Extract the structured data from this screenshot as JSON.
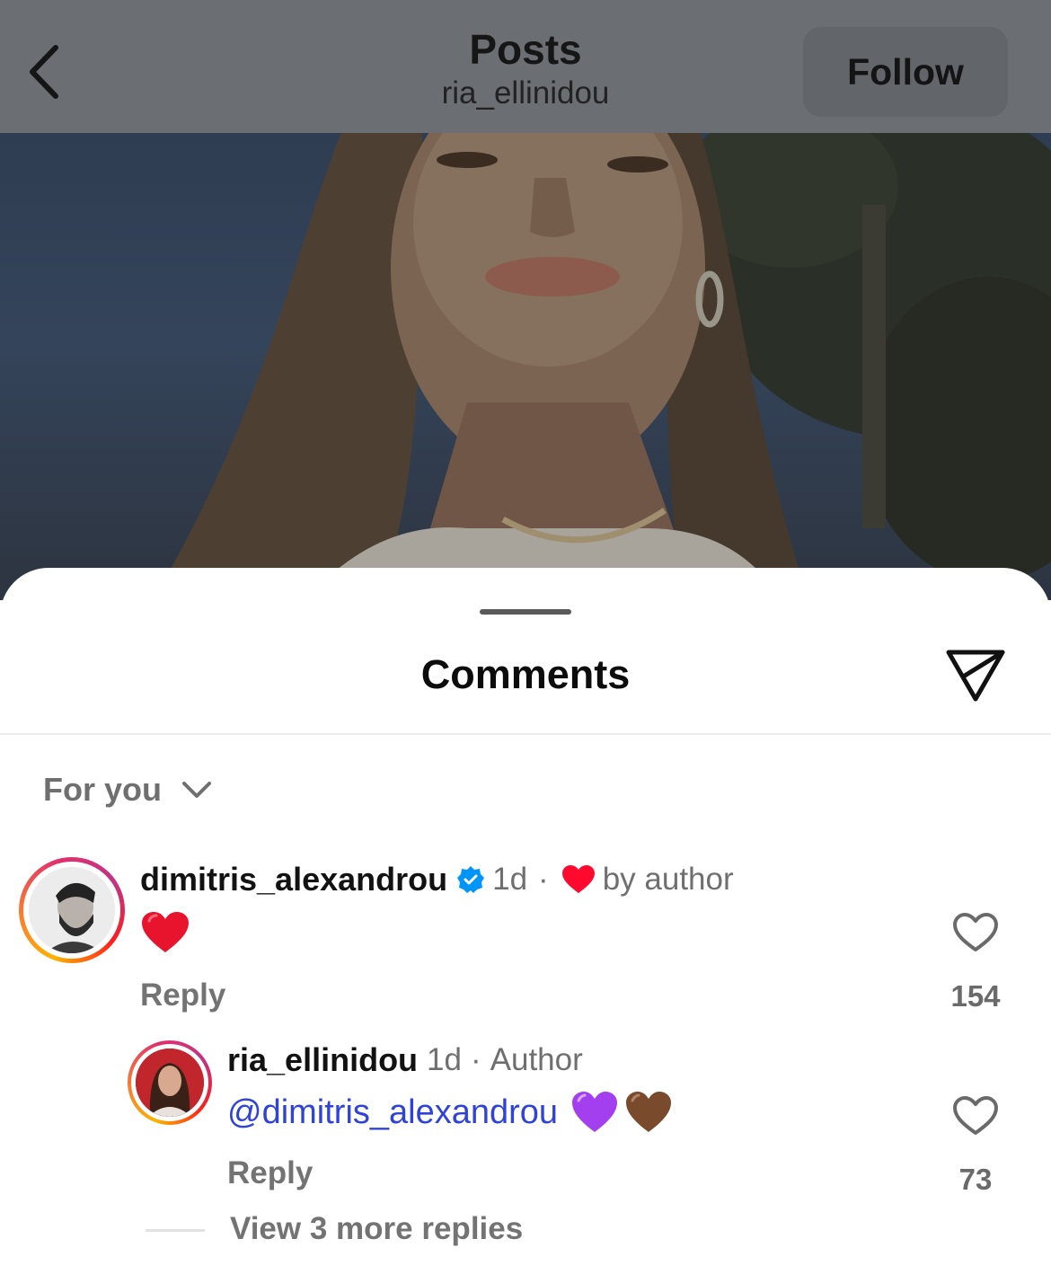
{
  "header": {
    "title": "Posts",
    "subtitle": "ria_ellinidou",
    "follow_label": "Follow"
  },
  "sheet": {
    "title": "Comments",
    "sort_label": "For you"
  },
  "comments": [
    {
      "username": "dimitris_alexandrou",
      "verified": true,
      "time": "1d",
      "separator": "·",
      "liked_by_author_text": "by author",
      "body_emoji": "❤️",
      "reply_label": "Reply",
      "like_count": "154"
    }
  ],
  "replies": [
    {
      "username": "ria_ellinidou",
      "time": "1d",
      "separator": "·",
      "author_badge": "Author",
      "mention": "@dimitris_alexandrou",
      "emojis": [
        "💜",
        "🤎"
      ],
      "reply_label": "Reply",
      "like_count": "73"
    }
  ],
  "view_more_replies": "View 3 more replies",
  "colors": {
    "verified_blue": "#0095f6",
    "heart_red": "#ff0a2e",
    "mention_blue": "#2f43d8",
    "topbar_dim": "#6b6e72"
  },
  "icons": [
    "chevron-left-icon",
    "send-icon",
    "chevron-down-icon",
    "verified-badge-icon",
    "heart-filled-icon",
    "heart-outline-icon"
  ]
}
